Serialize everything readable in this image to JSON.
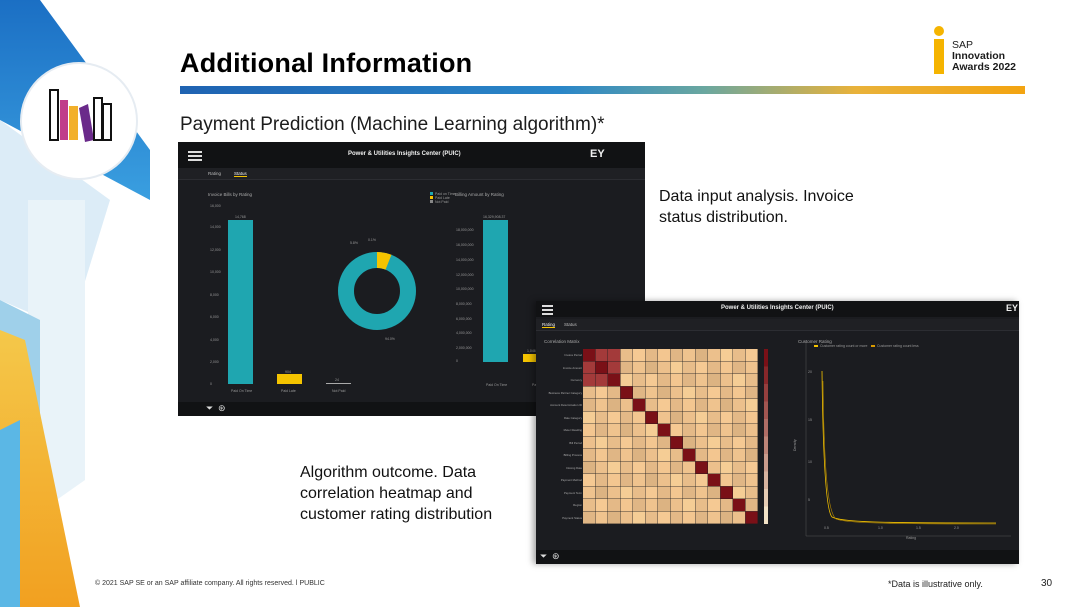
{
  "slide": {
    "title": "Additional Information",
    "subtitle": "Payment Prediction (Machine Learning algorithm)*",
    "award": {
      "line1": "SAP",
      "line2": "Innovation",
      "line3": "Awards 2022"
    },
    "desc_input": "Data input analysis. Invoice status distribution.",
    "desc_outcome": "Algorithm outcome. Data correlation heatmap and customer rating distribution",
    "footer_copyright": "© 2021 SAP SE or an SAP affiliate company. All rights reserved. ǀ PUBLIC",
    "footer_note": "*Data is illustrative only.",
    "page_number": "30"
  },
  "dashboard1": {
    "app_title": "Power & Utilities Insights Center (PUIC)",
    "brand": "EY",
    "tabs": [
      "Rating",
      "Status"
    ],
    "active_tab": "Status",
    "panel_left_title": "Invoice Bills by Rating",
    "panel_right_title": "Billing Amount by Rating",
    "legend": [
      "Paid on Time",
      "Paid Late",
      "Not Paid"
    ],
    "bar_categories": [
      "Paid On Time",
      "Paid Late",
      "Not Paid"
    ],
    "bar_labels": [
      "14,768",
      "904",
      "24"
    ],
    "y_ticks": [
      "0",
      "2,000",
      "4,000",
      "6,000",
      "8,000",
      "10,000",
      "12,000",
      "14,000",
      "16,000"
    ],
    "donut_labels": [
      "5.8%",
      "0.1%",
      "94.0%"
    ],
    "right_bar_label": "16,329,908.37",
    "right_bar_label2": "1,046",
    "right_y_ticks": [
      "0",
      "2,000,000",
      "4,000,000",
      "6,000,000",
      "8,000,000",
      "10,000,000",
      "12,000,000",
      "14,000,000",
      "16,000,000",
      "18,000,000"
    ],
    "right_x_label": "Paid On Time",
    "right_x_label2": "Pai"
  },
  "dashboard2": {
    "app_title": "Power & Utilities Insights Center (PUIC)",
    "brand": "EY",
    "tabs": [
      "Rating",
      "Status"
    ],
    "active_tab": "Rating",
    "panel_left_title": "Correlation Matrix",
    "panel_right_title": "Customer Rating",
    "legend": [
      "Customer rating count or more",
      "Customer rating count less"
    ],
    "row_labels": [
      "Invoice Period",
      "Invoice Amount",
      "Currency",
      "Business Partner Category",
      "Account Determination ID",
      "Rate Category",
      "Meter Reading",
      "Bill Period",
      "Billing Process",
      "Closing Date",
      "Payment Method",
      "Payment Term",
      "Region",
      "Payment Status"
    ],
    "x_axis_label": "Rating",
    "y_axis_label": "Density",
    "x_ticks": [
      "0.5",
      "1.0",
      "1.5",
      "2.0"
    ],
    "y_ticks": [
      "20",
      "15",
      "10",
      "5"
    ]
  },
  "colors": {
    "accent_yellow": "#f5c400",
    "teal": "#1fa6b0",
    "heat_dark": "#7a1017",
    "heat_light": "#f3e3c6"
  }
}
